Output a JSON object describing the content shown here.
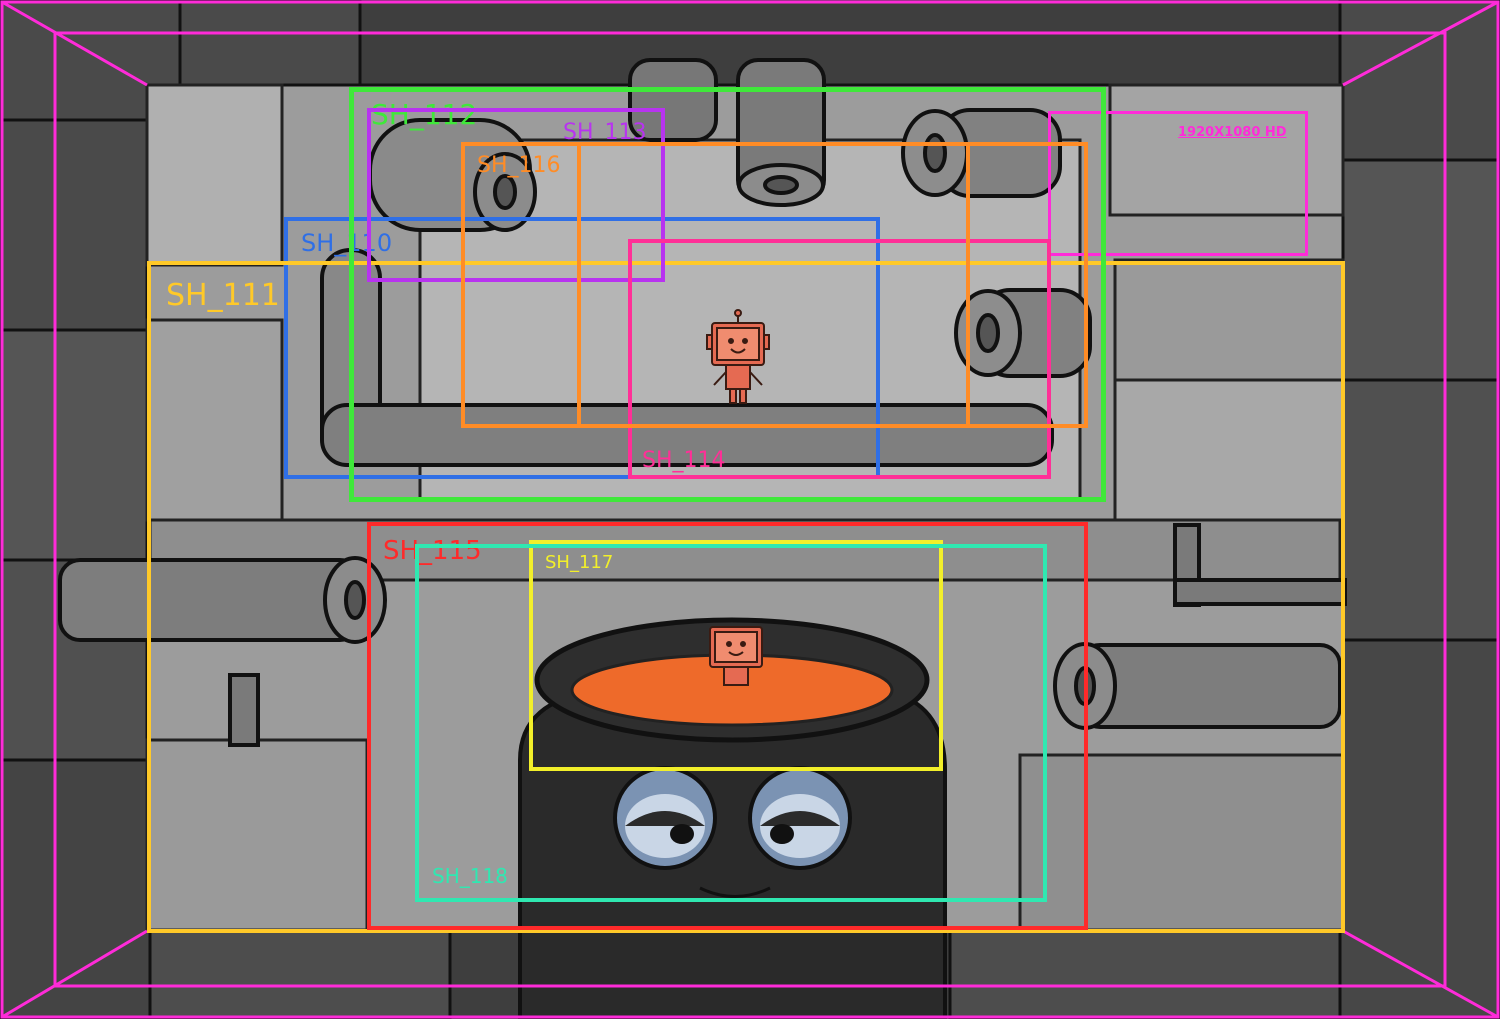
{
  "format_label": "1920X1080 HD",
  "frames": [
    {
      "id": "SH_110",
      "color": "#2f6fe6"
    },
    {
      "id": "SH_111",
      "color": "#ffc928"
    },
    {
      "id": "SH_112",
      "color": "#3fe83a"
    },
    {
      "id": "SH_113",
      "color": "#b833f0"
    },
    {
      "id": "SH_114",
      "color": "#ff2f97"
    },
    {
      "id": "SH_115",
      "color": "#ff2a2a"
    },
    {
      "id": "SH_116",
      "color": "#ff8c26"
    },
    {
      "id": "SH_117",
      "color": "#f2ef2a"
    },
    {
      "id": "SH_118",
      "color": "#2fe8b1"
    }
  ],
  "colors": {
    "safe_frame": "#ff2bd9",
    "wall_dark": "#3a3a3a",
    "wall_mid": "#5a5a5a",
    "wall_light": "#a8a8a8",
    "pipe": "#8a8a8a",
    "cauldron": "#2b2b2b",
    "liquid": "#ee6a2a",
    "robot": "#e56a52",
    "eye": "#7b93b3"
  }
}
